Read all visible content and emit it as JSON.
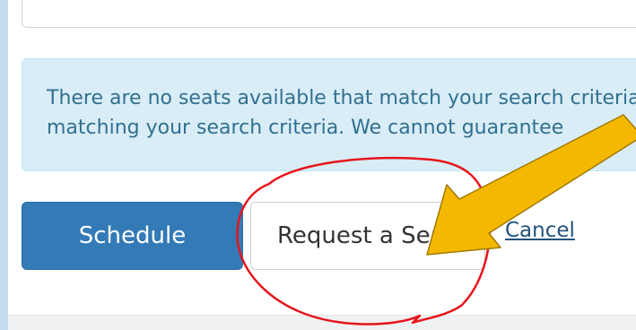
{
  "alert": {
    "line1": "There are no seats available that match your search criteria.",
    "line2": "matching your search criteria. We cannot guarantee"
  },
  "actions": {
    "schedule_label": "Schedule",
    "request_seat_label": "Request a Seat",
    "cancel_label": "Cancel"
  },
  "colors": {
    "primary": "#337ab7",
    "alert_bg": "#d9edf7",
    "alert_text": "#31708f",
    "link": "#23527c",
    "annotation_circle": "#e8141b",
    "annotation_arrow": "#f5b800"
  }
}
